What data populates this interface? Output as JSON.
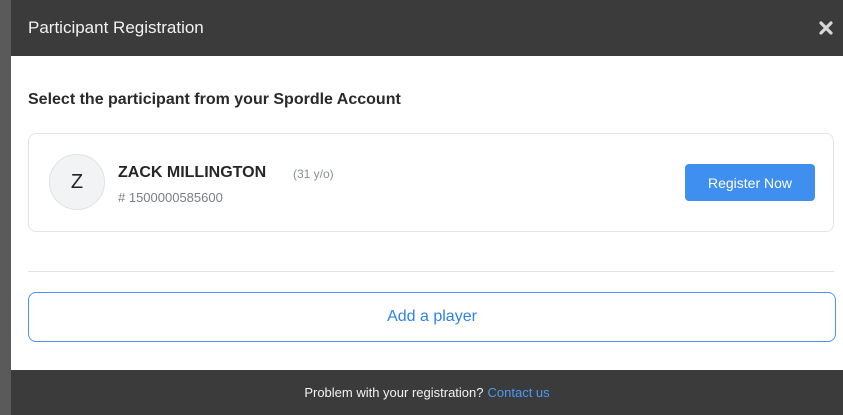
{
  "modal": {
    "title": "Participant Registration",
    "close_icon": "close-icon",
    "heading": "Select the participant from your Spordle Account"
  },
  "participant": {
    "initial": "Z",
    "name": "ZACK MILLINGTON",
    "age": "(31 y/o)",
    "id": "# 1500000585600",
    "register_label": "Register Now"
  },
  "add_player_label": "Add a player",
  "footer": {
    "text": "Problem with your registration?",
    "link": "Contact us"
  },
  "colors": {
    "header_bg": "#3b3b3b",
    "primary": "#3f8ff0",
    "link": "#4a9bf5"
  }
}
